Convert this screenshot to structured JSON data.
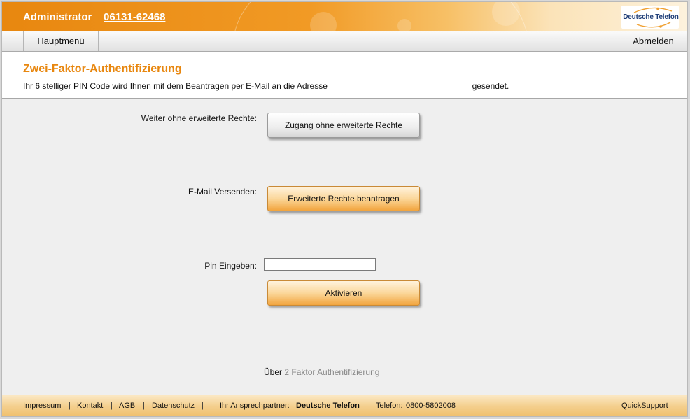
{
  "header": {
    "user_label": "Administrator",
    "phone": "06131-62468",
    "logo_text": "Deutsche Telefon"
  },
  "nav": {
    "home": "Hauptmenü",
    "logout": "Abmelden"
  },
  "page": {
    "title": "Zwei-Faktor-Authentifizierung",
    "intro_before": "Ihr 6 stelliger PIN Code wird Ihnen mit dem Beantragen per E-Mail an die Adresse",
    "intro_after": "gesendet."
  },
  "actions": {
    "no_rights_label": "Weiter ohne erweiterte Rechte:",
    "no_rights_button": "Zugang ohne erweiterte Rechte",
    "email_label": "E-Mail Versenden:",
    "email_button": "Erweiterte Rechte beantragen",
    "pin_label": "Pin Eingeben:",
    "pin_value": "",
    "activate_button": "Aktivieren"
  },
  "about": {
    "prefix": "Über",
    "link": "2 Faktor Authentifizierung"
  },
  "footer": {
    "impressum": "Impressum",
    "kontakt": "Kontakt",
    "agb": "AGB",
    "datenschutz": "Datenschutz",
    "separator": "|",
    "partner_label": "Ihr Ansprechpartner:",
    "partner_name": "Deutsche Telefon",
    "phone_label": "Telefon:",
    "phone": "0800-5802008",
    "quicksupport": "QuickSupport"
  },
  "colors": {
    "accent": "#e8870f",
    "title": "#e8870f",
    "logo_blue": "#1f3e78"
  }
}
